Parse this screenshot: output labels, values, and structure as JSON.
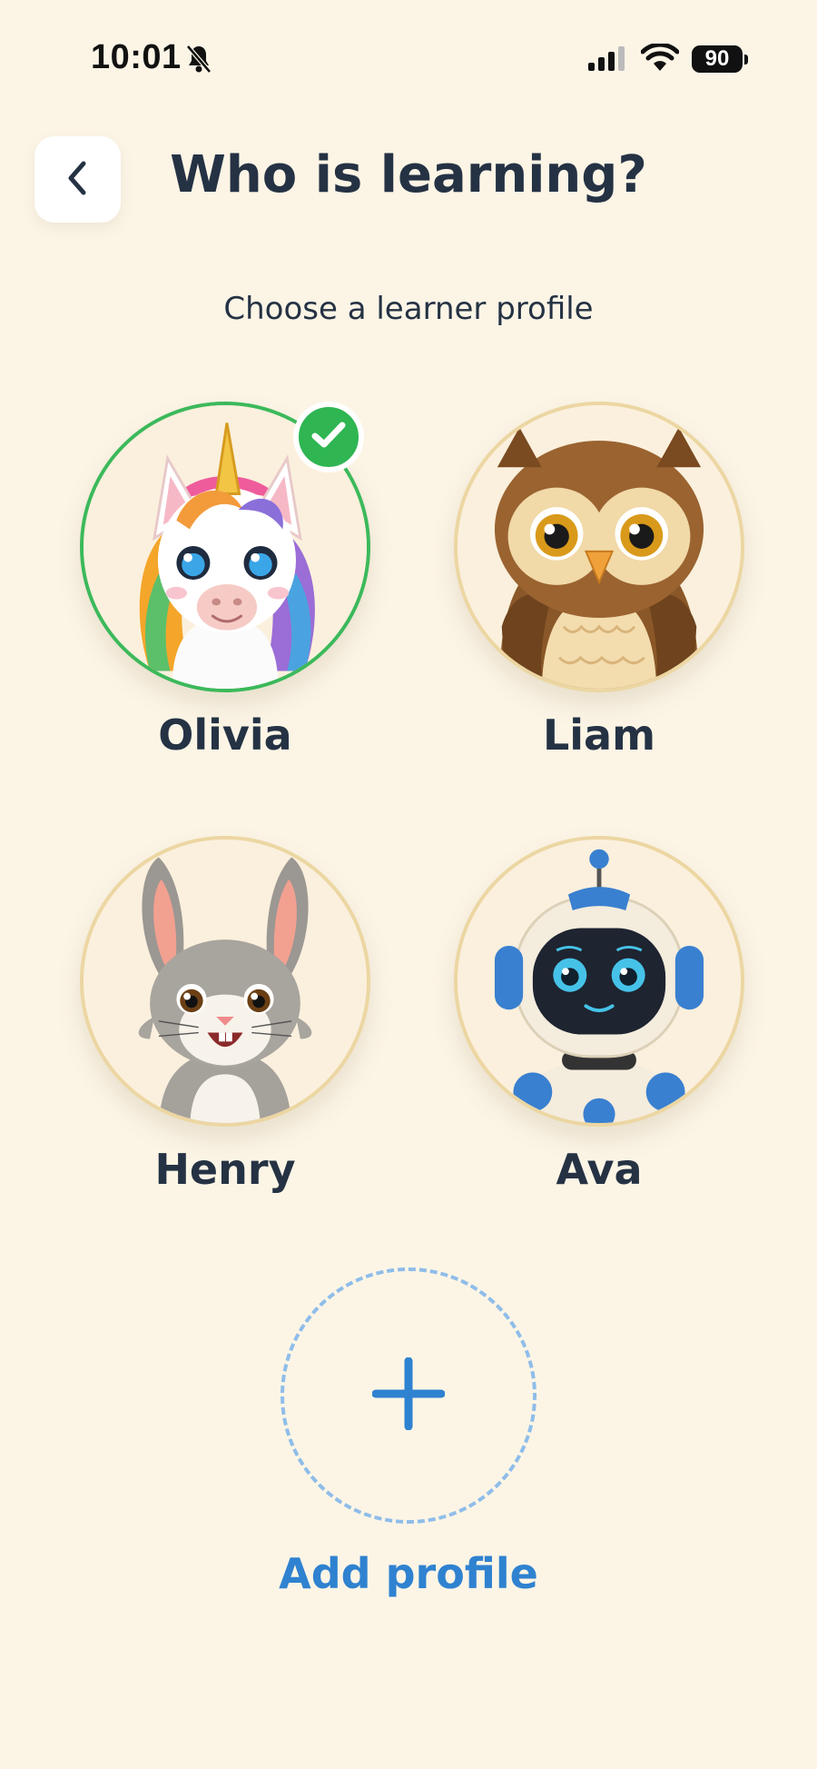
{
  "status_bar": {
    "time": "10:01",
    "battery": "90",
    "icons": [
      "bell-slash-icon",
      "signal-icon",
      "wifi-icon",
      "battery-icon"
    ]
  },
  "header": {
    "back_icon": "chevron-left-icon",
    "title": "Who is learning?"
  },
  "subtitle": "Choose a learner profile",
  "profiles": [
    {
      "name": "Olivia",
      "avatar": "unicorn",
      "selected": true
    },
    {
      "name": "Liam",
      "avatar": "owl",
      "selected": false
    },
    {
      "name": "Henry",
      "avatar": "bunny",
      "selected": false
    },
    {
      "name": "Ava",
      "avatar": "robot",
      "selected": false
    }
  ],
  "add_profile": {
    "icon": "plus-icon",
    "label": "Add profile"
  },
  "colors": {
    "background": "#fcf5e6",
    "text": "#253244",
    "selected": "#3cb95b",
    "accent": "#2f82d0",
    "avatar_border": "#ecd6a2"
  }
}
